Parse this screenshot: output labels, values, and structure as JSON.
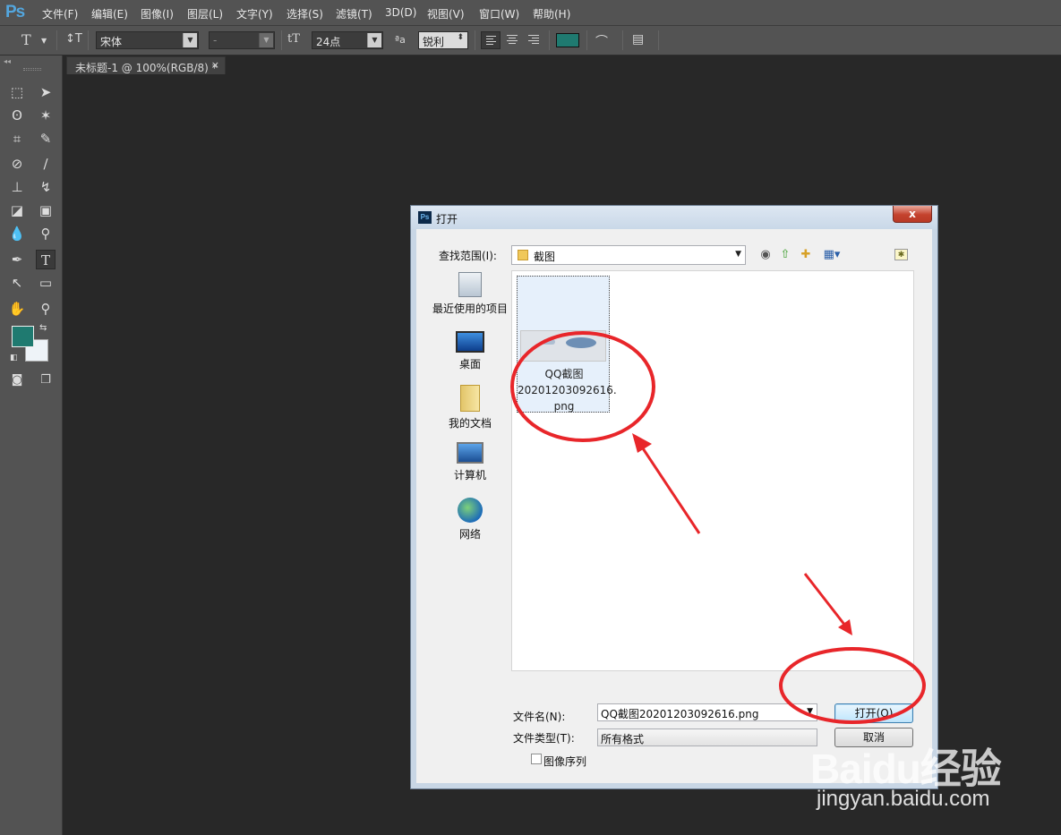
{
  "app": {
    "logo": "Ps"
  },
  "menubar": {
    "items": [
      "文件(F)",
      "编辑(E)",
      "图像(I)",
      "图层(L)",
      "文字(Y)",
      "选择(S)",
      "滤镜(T)",
      "3D(D)",
      "视图(V)",
      "窗口(W)",
      "帮助(H)"
    ]
  },
  "options": {
    "tool_icon": "T",
    "font_family": "宋体",
    "font_style": "-",
    "font_size": "24点",
    "antialias": "锐利",
    "text_color": "#1f7a70"
  },
  "document": {
    "tab_title": "未标题-1 @ 100%(RGB/8) *",
    "close": "×"
  },
  "toolbox": {
    "foreground_color": "#1f7a70",
    "background_color": "#eef3f8"
  },
  "dialog": {
    "title": "打开",
    "close_glyph": "x",
    "lookin_label": "查找范围(I):",
    "lookin_value": "截图",
    "places": [
      {
        "label": "最近使用的项目",
        "icon": "recent-items-icon"
      },
      {
        "label": "桌面",
        "icon": "desktop-icon"
      },
      {
        "label": "我的文档",
        "icon": "my-documents-icon"
      },
      {
        "label": "计算机",
        "icon": "computer-icon"
      },
      {
        "label": "网络",
        "icon": "network-icon"
      }
    ],
    "file": {
      "name_line1": "QQ截图",
      "name_line2": "20201203092616.",
      "name_line3": "png"
    },
    "filename_label": "文件名(N):",
    "filename_value": "QQ截图20201203092616.png",
    "filetype_label": "文件类型(T):",
    "filetype_value": "所有格式",
    "open_button": "打开(O)",
    "cancel_button": "取消",
    "image_sequence_label": "图像序列"
  },
  "annotations": {
    "circle_color": "#e8262a"
  },
  "watermark": {
    "logo": "Baidu经验",
    "url": "jingyan.baidu.com"
  }
}
